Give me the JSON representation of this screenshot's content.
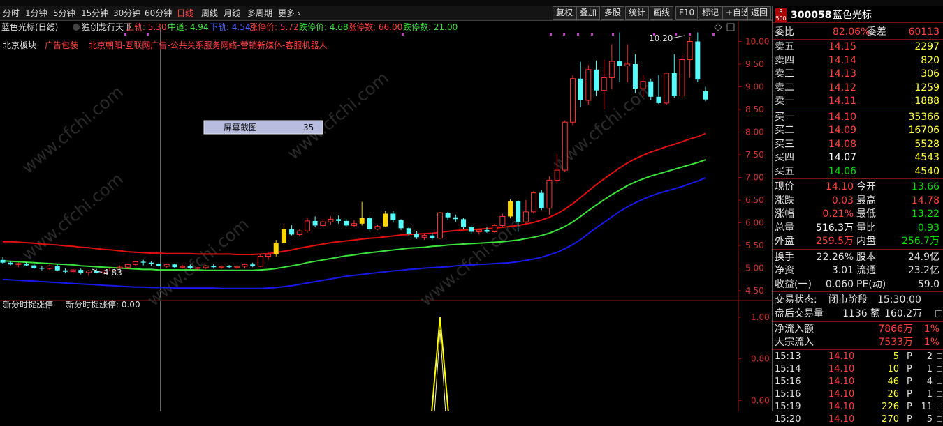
{
  "toolbar": {
    "periods": [
      "分时",
      "1分钟",
      "5分钟",
      "15分钟",
      "30分钟",
      "60分钟",
      "日线",
      "周线",
      "月线",
      "多周期",
      "更多 ›"
    ],
    "selected_index": 6,
    "right_buttons": [
      "复权",
      "叠加",
      "多股",
      "统计",
      "画线",
      "F10",
      "标记",
      "+自选",
      "返回"
    ]
  },
  "indicator_bar": {
    "title": "蓝色光标(日线)",
    "name": "独创龙行天下",
    "upper": "上轨: 5.30",
    "middle": "中道: 4.94",
    "lower": "下轨: 4.54",
    "limit_up_price": "涨停价: 5.72",
    "limit_down_price": "跌停价: 4.68",
    "limit_up_count": "涨停数: 66.00",
    "limit_down_count": "跌停数: 21.00"
  },
  "tags": {
    "sector": "北京板块",
    "ad": "广告包装",
    "concepts": "北京朝阳-互联网广告-公共关系服务网络-营销新媒体-客服机器人"
  },
  "popup": {
    "label": "屏幕截图",
    "value": "35"
  },
  "annotations": {
    "high": "10.20",
    "low": "4.83"
  },
  "watermark": "www.cfchi.com",
  "lower_panel": {
    "title": "新分时捉涨停",
    "value_label": "新分时捉涨停: 0.00"
  },
  "chart_data": [
    {
      "type": "candlestick",
      "title": "蓝色光标(日线)",
      "y_ticks": [
        "10.00",
        "9.50",
        "9.00",
        "8.50",
        "8.00",
        "7.50",
        "7.00",
        "6.50",
        "6.00",
        "5.50",
        "5.00",
        "4.50"
      ],
      "ylim": [
        4.3,
        10.3
      ],
      "candles_ohlc": [
        [
          5.18,
          5.24,
          5.1,
          5.12
        ],
        [
          5.12,
          5.15,
          5.06,
          5.08
        ],
        [
          5.08,
          5.12,
          5.02,
          5.1
        ],
        [
          5.1,
          5.13,
          5.05,
          5.06
        ],
        [
          5.06,
          5.08,
          4.98,
          5.0
        ],
        [
          5.0,
          5.05,
          4.95,
          4.99
        ],
        [
          4.99,
          5.08,
          4.96,
          5.05
        ],
        [
          5.05,
          5.08,
          4.93,
          4.95
        ],
        [
          4.95,
          4.99,
          4.88,
          4.92
        ],
        [
          4.92,
          4.98,
          4.88,
          4.96
        ],
        [
          4.96,
          4.99,
          4.86,
          4.9
        ],
        [
          4.9,
          4.96,
          4.83,
          4.94
        ],
        [
          4.94,
          4.98,
          4.88,
          4.9
        ],
        [
          4.9,
          4.96,
          4.86,
          4.94
        ],
        [
          4.94,
          5.02,
          4.92,
          5.0
        ],
        [
          5.0,
          5.06,
          4.96,
          5.02
        ],
        [
          5.02,
          5.1,
          4.98,
          5.08
        ],
        [
          5.08,
          5.16,
          5.04,
          5.14
        ],
        [
          5.14,
          5.18,
          5.06,
          5.12
        ],
        [
          5.12,
          5.15,
          5.04,
          5.1
        ],
        [
          5.1,
          5.12,
          5.02,
          5.04
        ],
        [
          5.04,
          5.1,
          5.01,
          5.08
        ],
        [
          5.08,
          5.1,
          5.0,
          5.02
        ],
        [
          5.02,
          5.07,
          4.99,
          5.04
        ],
        [
          5.04,
          5.08,
          4.98,
          5.0
        ],
        [
          5.0,
          5.03,
          4.96,
          5.01
        ],
        [
          5.01,
          5.07,
          4.98,
          5.05
        ],
        [
          5.05,
          5.09,
          4.99,
          5.02
        ],
        [
          5.02,
          5.06,
          4.98,
          5.04
        ],
        [
          5.04,
          5.07,
          5.0,
          5.02
        ],
        [
          5.02,
          5.06,
          4.98,
          5.04
        ],
        [
          5.04,
          5.1,
          5.0,
          5.08
        ],
        [
          5.08,
          5.12,
          5.02,
          5.04
        ],
        [
          5.04,
          5.3,
          5.02,
          5.26
        ],
        [
          5.26,
          5.34,
          5.18,
          5.3
        ],
        [
          5.3,
          5.62,
          5.26,
          5.56
        ],
        [
          5.56,
          5.98,
          5.5,
          5.86
        ],
        [
          5.86,
          5.95,
          5.72,
          5.74
        ],
        [
          5.74,
          5.86,
          5.7,
          5.82
        ],
        [
          5.82,
          6.12,
          5.78,
          6.04
        ],
        [
          6.04,
          6.14,
          5.9,
          5.94
        ],
        [
          5.94,
          6.08,
          5.9,
          6.02
        ],
        [
          6.02,
          6.14,
          5.96,
          6.08
        ],
        [
          6.08,
          6.16,
          5.98,
          6.04
        ],
        [
          6.04,
          6.08,
          5.92,
          5.94
        ],
        [
          5.94,
          6.06,
          5.9,
          5.98
        ],
        [
          5.98,
          6.46,
          5.94,
          6.1
        ],
        [
          6.1,
          6.14,
          5.82,
          5.86
        ],
        [
          5.86,
          5.96,
          5.84,
          5.92
        ],
        [
          5.92,
          6.26,
          5.9,
          6.2
        ],
        [
          6.2,
          6.26,
          6.0,
          6.06
        ],
        [
          6.06,
          6.08,
          5.84,
          5.88
        ],
        [
          5.88,
          5.92,
          5.7,
          5.76
        ],
        [
          5.76,
          5.82,
          5.64,
          5.68
        ],
        [
          5.68,
          5.76,
          5.62,
          5.72
        ],
        [
          5.72,
          5.78,
          5.62,
          5.66
        ],
        [
          5.66,
          6.24,
          5.64,
          6.22
        ],
        [
          6.22,
          6.24,
          6.06,
          6.12
        ],
        [
          6.12,
          6.18,
          6.02,
          6.08
        ],
        [
          6.08,
          6.1,
          5.86,
          5.9
        ],
        [
          5.9,
          5.96,
          5.76,
          5.8
        ],
        [
          5.8,
          5.86,
          5.74,
          5.84
        ],
        [
          5.84,
          5.9,
          5.78,
          5.8
        ],
        [
          5.8,
          5.98,
          5.78,
          5.94
        ],
        [
          5.94,
          6.2,
          5.9,
          6.14
        ],
        [
          6.14,
          6.52,
          6.1,
          6.48
        ],
        [
          6.48,
          6.5,
          5.8,
          6.02
        ],
        [
          6.02,
          6.5,
          5.98,
          6.24
        ],
        [
          6.24,
          6.7,
          6.2,
          6.66
        ],
        [
          6.66,
          6.72,
          6.28,
          6.32
        ],
        [
          6.32,
          7.02,
          6.18,
          6.94
        ],
        [
          6.94,
          7.52,
          6.88,
          7.16
        ],
        [
          7.16,
          8.26,
          7.12,
          8.22
        ],
        [
          8.22,
          9.26,
          8.14,
          9.18
        ],
        [
          9.18,
          9.55,
          8.55,
          8.7
        ],
        [
          8.7,
          9.48,
          8.6,
          9.38
        ],
        [
          9.38,
          9.58,
          8.8,
          8.92
        ],
        [
          8.92,
          9.6,
          8.5,
          9.2
        ],
        [
          9.2,
          9.94,
          8.94,
          9.56
        ],
        [
          9.56,
          10.2,
          9.1,
          9.46
        ],
        [
          9.46,
          9.94,
          9.1,
          9.5
        ],
        [
          9.5,
          9.72,
          8.86,
          8.96
        ],
        [
          8.96,
          9.26,
          8.78,
          9.12
        ],
        [
          9.12,
          9.18,
          8.7,
          8.78
        ],
        [
          8.78,
          9.26,
          8.62,
          8.64
        ],
        [
          8.64,
          9.32,
          8.6,
          9.3
        ],
        [
          9.3,
          9.72,
          8.76,
          8.8
        ],
        [
          8.8,
          9.7,
          8.76,
          9.6
        ],
        [
          9.6,
          10.1,
          9.2,
          10.0
        ],
        [
          10.0,
          10.2,
          9.1,
          9.16
        ],
        [
          8.9,
          9.0,
          8.68,
          8.72
        ]
      ],
      "series": [
        {
          "name": "上轨",
          "values": [
            5.58,
            5.58,
            5.57,
            5.56,
            5.55,
            5.53,
            5.52,
            5.51,
            5.49,
            5.48,
            5.46,
            5.45,
            5.43,
            5.41,
            5.4,
            5.38,
            5.36,
            5.35,
            5.34,
            5.33,
            5.33,
            5.32,
            5.32,
            5.32,
            5.32,
            5.31,
            5.31,
            5.31,
            5.31,
            5.31,
            5.3,
            5.3,
            5.3,
            5.31,
            5.32,
            5.34,
            5.37,
            5.4,
            5.44,
            5.47,
            5.5,
            5.53,
            5.56,
            5.58,
            5.6,
            5.62,
            5.64,
            5.66,
            5.67,
            5.69,
            5.71,
            5.73,
            5.74,
            5.75,
            5.76,
            5.77,
            5.79,
            5.81,
            5.83,
            5.84,
            5.85,
            5.86,
            5.87,
            5.88,
            5.9,
            5.92,
            5.94,
            5.97,
            6.01,
            6.06,
            6.12,
            6.2,
            6.3,
            6.42,
            6.56,
            6.7,
            6.84,
            6.97,
            7.09,
            7.21,
            7.32,
            7.41,
            7.49,
            7.56,
            7.62,
            7.68,
            7.73,
            7.79,
            7.85,
            7.9,
            7.97
          ]
        },
        {
          "name": "中道",
          "values": [
            5.16,
            5.15,
            5.14,
            5.13,
            5.12,
            5.11,
            5.1,
            5.09,
            5.08,
            5.07,
            5.05,
            5.04,
            5.03,
            5.02,
            5.01,
            5.0,
            4.99,
            4.98,
            4.97,
            4.97,
            4.96,
            4.96,
            4.96,
            4.96,
            4.96,
            4.96,
            4.95,
            4.95,
            4.95,
            4.95,
            4.95,
            4.95,
            4.95,
            4.96,
            4.97,
            4.99,
            5.02,
            5.05,
            5.08,
            5.12,
            5.15,
            5.18,
            5.21,
            5.24,
            5.27,
            5.29,
            5.32,
            5.34,
            5.36,
            5.38,
            5.4,
            5.42,
            5.44,
            5.45,
            5.46,
            5.48,
            5.49,
            5.51,
            5.52,
            5.53,
            5.54,
            5.55,
            5.56,
            5.57,
            5.58,
            5.6,
            5.62,
            5.65,
            5.68,
            5.72,
            5.77,
            5.84,
            5.92,
            6.02,
            6.14,
            6.27,
            6.39,
            6.51,
            6.62,
            6.72,
            6.82,
            6.9,
            6.97,
            7.03,
            7.08,
            7.13,
            7.18,
            7.23,
            7.28,
            7.33,
            7.39
          ]
        },
        {
          "name": "下轨",
          "values": [
            4.75,
            4.74,
            4.73,
            4.72,
            4.71,
            4.7,
            4.69,
            4.68,
            4.67,
            4.66,
            4.65,
            4.64,
            4.63,
            4.62,
            4.61,
            4.6,
            4.59,
            4.58,
            4.58,
            4.57,
            4.57,
            4.57,
            4.56,
            4.56,
            4.56,
            4.56,
            4.56,
            4.56,
            4.55,
            4.55,
            4.55,
            4.55,
            4.55,
            4.55,
            4.56,
            4.57,
            4.59,
            4.61,
            4.64,
            4.67,
            4.7,
            4.73,
            4.76,
            4.79,
            4.82,
            4.84,
            4.86,
            4.88,
            4.9,
            4.92,
            4.94,
            4.95,
            4.97,
            4.98,
            5.0,
            5.01,
            5.02,
            5.03,
            5.05,
            5.06,
            5.07,
            5.08,
            5.09,
            5.1,
            5.11,
            5.12,
            5.14,
            5.17,
            5.2,
            5.24,
            5.29,
            5.35,
            5.43,
            5.52,
            5.63,
            5.76,
            5.89,
            6.01,
            6.13,
            6.25,
            6.35,
            6.44,
            6.52,
            6.59,
            6.65,
            6.7,
            6.75,
            6.8,
            6.86,
            6.92,
            6.99
          ]
        }
      ],
      "colors": {
        "up": "#ff3232",
        "down": "#54fcfc",
        "limit_up": "#ffd700",
        "upper": "#e01010",
        "middle": "#3ce23c",
        "lower": "#1818e8"
      }
    },
    {
      "type": "line",
      "title": "新分时捉涨停",
      "y_ticks": [
        "1.00",
        "0.80",
        "0.60",
        "0.40"
      ],
      "ylim": [
        0.28,
        1.05
      ],
      "series": [
        {
          "name": "新分时捉涨停",
          "spike_index": 56,
          "values": [
            0,
            1,
            0
          ]
        }
      ],
      "color": "#ffff00"
    }
  ],
  "quote": {
    "code": "300058",
    "name": "蓝色光标",
    "flag": "R 500",
    "weibi_label": "委比",
    "weibi_value": "82.06%",
    "weicha_label": "委差",
    "weicha_value": "60113",
    "asks": [
      {
        "label": "卖五",
        "price": "14.15",
        "vol": "2297"
      },
      {
        "label": "卖四",
        "price": "14.14",
        "vol": "820"
      },
      {
        "label": "卖三",
        "price": "14.13",
        "vol": "306"
      },
      {
        "label": "卖二",
        "price": "14.12",
        "vol": "1259"
      },
      {
        "label": "卖一",
        "price": "14.11",
        "vol": "1888"
      }
    ],
    "bids": [
      {
        "label": "买一",
        "price": "14.10",
        "vol": "35366",
        "color": "#ff4040"
      },
      {
        "label": "买二",
        "price": "14.09",
        "vol": "16706",
        "color": "#ff4040"
      },
      {
        "label": "买三",
        "price": "14.08",
        "vol": "5528",
        "color": "#ff4040"
      },
      {
        "label": "买四",
        "price": "14.07",
        "vol": "4543",
        "color": "#ffffff"
      },
      {
        "label": "买五",
        "price": "14.06",
        "vol": "4540",
        "color": "#00e000"
      }
    ],
    "stats": [
      {
        "l1": "现价",
        "v1": "14.10",
        "c1": "#ff4040",
        "l2": "今开",
        "v2": "13.66",
        "c2": "#00e000"
      },
      {
        "l1": "涨跌",
        "v1": "0.03",
        "c1": "#ff4040",
        "l2": "最高",
        "v2": "14.78",
        "c2": "#ff4040"
      },
      {
        "l1": "涨幅",
        "v1": "0.21%",
        "c1": "#ff4040",
        "l2": "最低",
        "v2": "13.22",
        "c2": "#00e000"
      },
      {
        "l1": "总量",
        "v1": "516.3万",
        "c1": "#ffffff",
        "l2": "量比",
        "v2": "0.93",
        "c2": "#00e000"
      },
      {
        "l1": "外盘",
        "v1": "259.5万",
        "c1": "#ff4040",
        "l2": "内盘",
        "v2": "256.7万",
        "c2": "#00e000"
      }
    ],
    "fund": [
      {
        "l1": "换手",
        "v1": "22.26%",
        "l2": "股本",
        "v2": "24.9亿"
      },
      {
        "l1": "净资",
        "v1": "3.01",
        "l2": "流通",
        "v2": "23.2亿"
      },
      {
        "l1": "收益(一)",
        "v1": "0.060",
        "l2": "PE(动)",
        "v2": "59.0"
      }
    ],
    "status_label": "交易状态:",
    "status_value": "闭市阶段",
    "status_time": "15:30:00",
    "after_label": "盘后交易量",
    "after_vol": "1136",
    "after_amt_label": "额",
    "after_amt": "160.2万",
    "flows": [
      {
        "label": "净流入额",
        "value": "7866万",
        "pct": "1%"
      },
      {
        "label": "大宗流入",
        "value": "7533万",
        "pct": "1%"
      }
    ],
    "ticks": [
      {
        "time": "15:13",
        "price": "14.10",
        "vol": "5",
        "flag": "P",
        "n": "2"
      },
      {
        "time": "15:14",
        "price": "14.10",
        "vol": "10",
        "flag": "P",
        "n": "1"
      },
      {
        "time": "15:16",
        "price": "14.10",
        "vol": "46",
        "flag": "P",
        "n": "4"
      },
      {
        "time": "15:16",
        "price": "14.10",
        "vol": "26",
        "flag": "P",
        "n": "1"
      },
      {
        "time": "15:19",
        "price": "14.10",
        "vol": "226",
        "flag": "P",
        "n": "11"
      },
      {
        "time": "15:20",
        "price": "14.10",
        "vol": "270",
        "flag": "P",
        "n": "5"
      }
    ]
  }
}
